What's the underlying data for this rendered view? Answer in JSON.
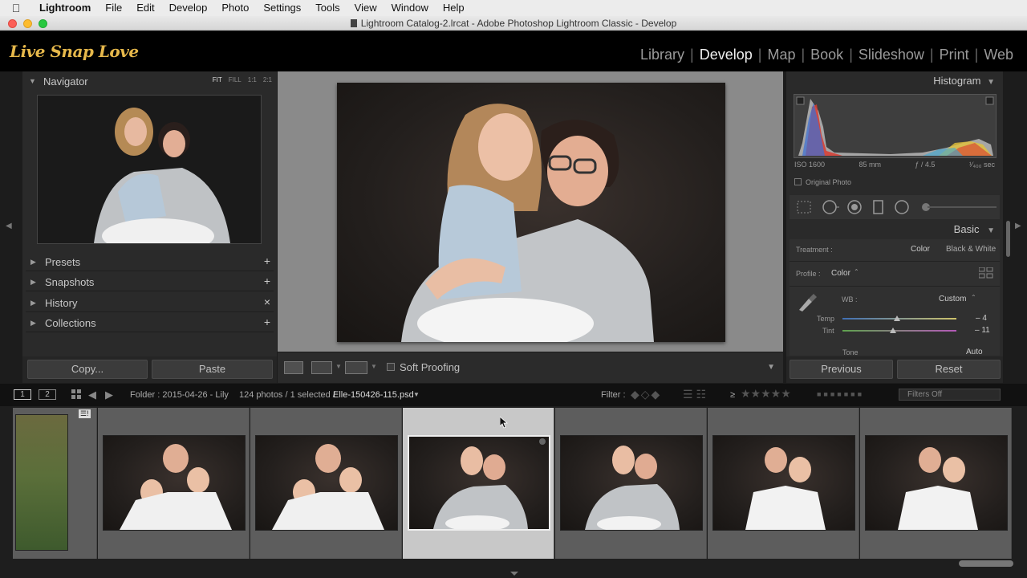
{
  "menubar": {
    "app": "Lightroom",
    "items": [
      "File",
      "Edit",
      "Develop",
      "Photo",
      "Settings",
      "Tools",
      "View",
      "Window",
      "Help"
    ]
  },
  "window": {
    "title": "Lightroom Catalog-2.lrcat - Adobe Photoshop Lightroom Classic - Develop"
  },
  "identity_plate": "Live Snap Love",
  "modules": [
    "Library",
    "Develop",
    "Map",
    "Book",
    "Slideshow",
    "Print",
    "Web"
  ],
  "active_module": "Develop",
  "left_panel": {
    "navigator": {
      "title": "Navigator",
      "zoom": [
        "FIT",
        "FILL",
        "1:1",
        "2:1"
      ],
      "zoom_active": "FIT"
    },
    "sections": [
      {
        "label": "Presets",
        "action": "+"
      },
      {
        "label": "Snapshots",
        "action": "+"
      },
      {
        "label": "History",
        "action": "×"
      },
      {
        "label": "Collections",
        "action": "+"
      }
    ],
    "copy_button": "Copy...",
    "paste_button": "Paste"
  },
  "toolbar": {
    "soft_proofing": "Soft Proofing"
  },
  "right_panel": {
    "histogram_title": "Histogram",
    "meta": {
      "iso": "ISO 1600",
      "focal": "85 mm",
      "aperture": "ƒ / 4.5",
      "shutter": "¹⁄₄₀₀ sec"
    },
    "original_photo": "Original Photo",
    "basic_title": "Basic",
    "treatment_label": "Treatment :",
    "treatment_color": "Color",
    "treatment_bw": "Black & White",
    "profile_label": "Profile :",
    "profile_value": "Color",
    "wb_label": "WB :",
    "wb_value": "Custom",
    "temp_label": "Temp",
    "temp_value": "– 4",
    "tint_label": "Tint",
    "tint_value": "– 11",
    "tone_label": "Tone",
    "tone_auto": "Auto",
    "previous_button": "Previous",
    "reset_button": "Reset"
  },
  "filmstrip_bar": {
    "page1": "1",
    "page2": "2",
    "folder": "Folder : 2015-04-26 - Lily",
    "count": "124 photos / 1 selected /",
    "filename": "Elle-150426-115.psd",
    "filter_label": "Filter :",
    "rating_op": "≥",
    "filters_off": "Filters Off"
  },
  "filmstrip": {
    "selected_index": 3,
    "count_thumbs": 7
  },
  "colors": {
    "accent": "#e6b84b",
    "panel": "#2a2a2a",
    "center_bg": "#8a8a8a",
    "selected_cell": "#c8c8c8"
  }
}
